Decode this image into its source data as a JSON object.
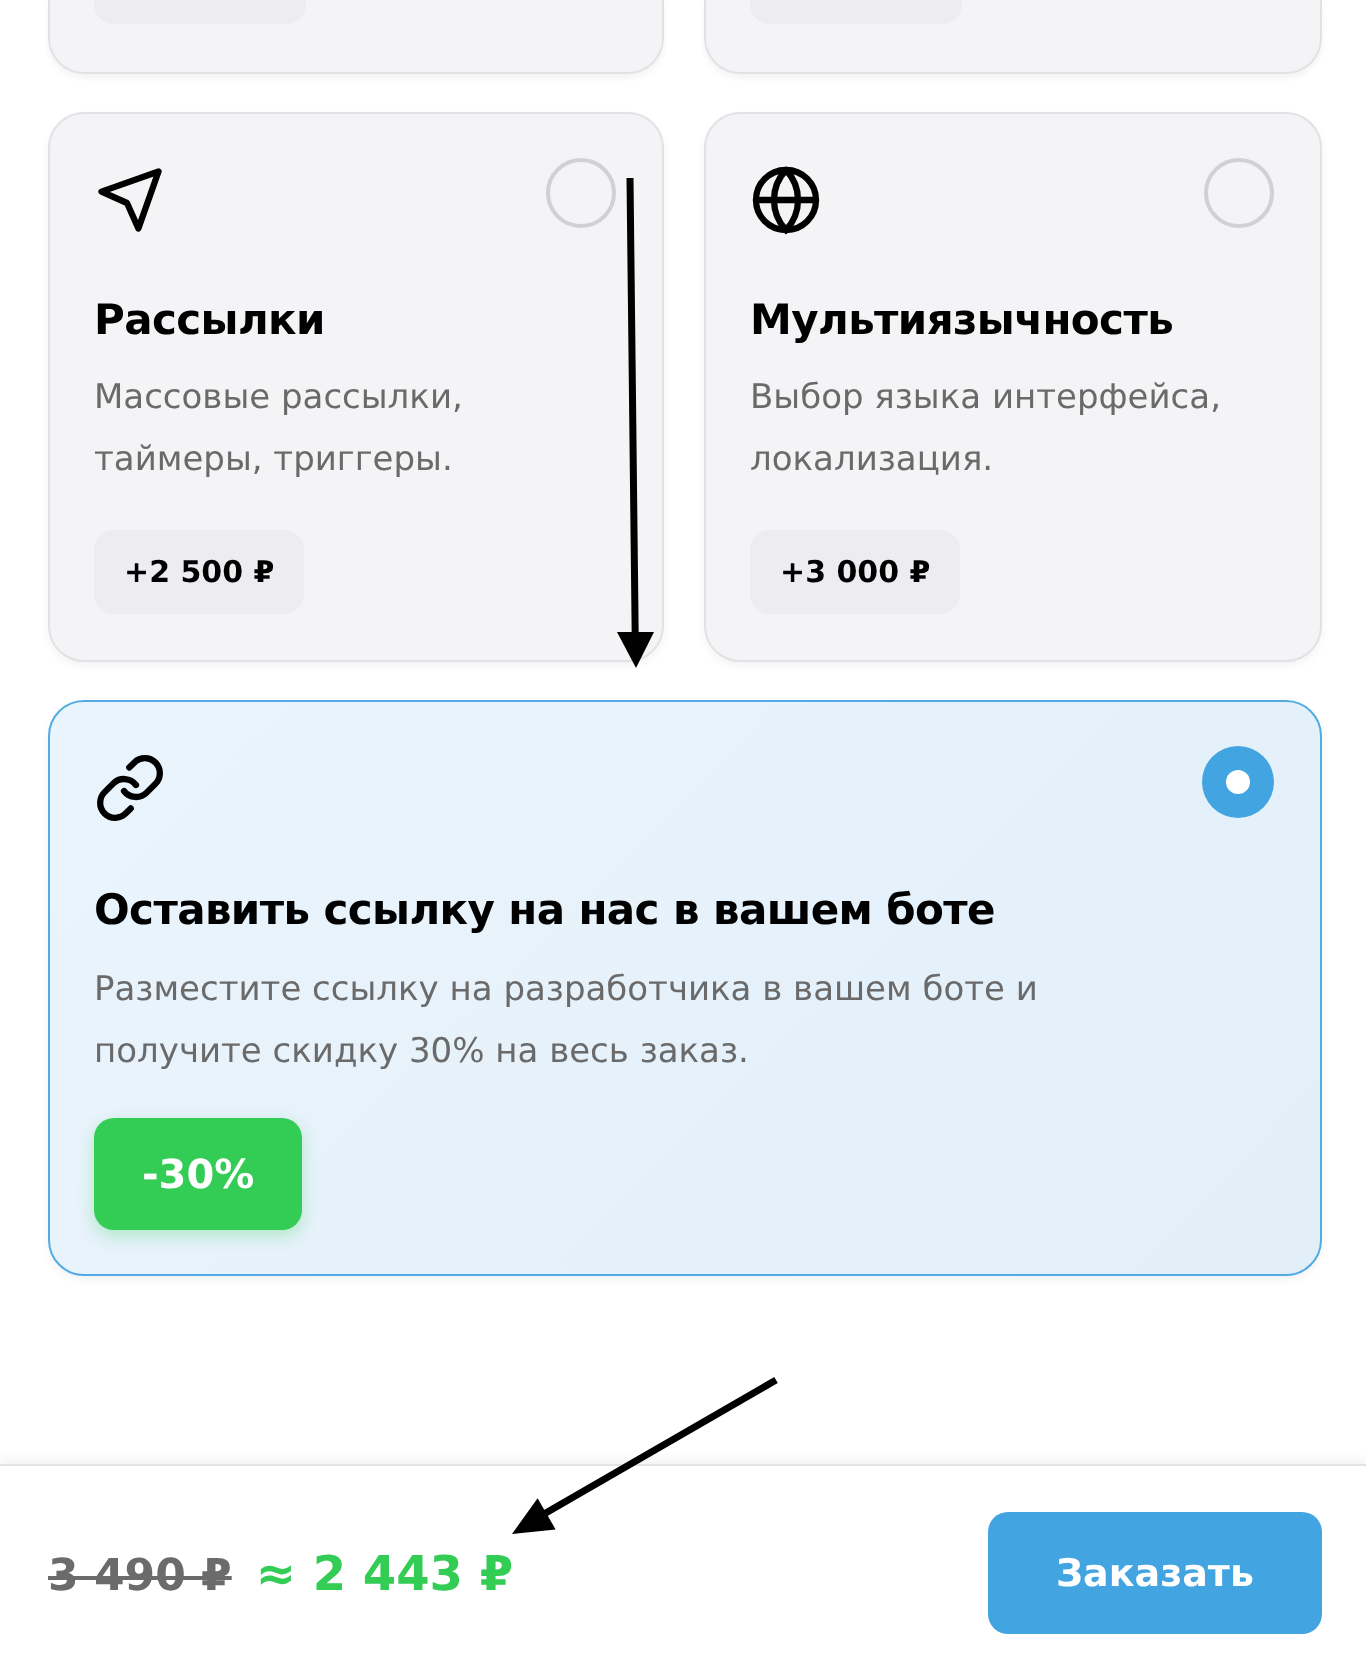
{
  "cut_off_cards": [
    {
      "kind": "option"
    },
    {
      "kind": "option"
    }
  ],
  "options": [
    {
      "kind": "addon",
      "title": "Рассылки",
      "description": "Массовые рассылки, таймеры, триггеры.",
      "price": "+2 500 ₽",
      "selected": false
    },
    {
      "kind": "addon",
      "title": "Мультиязычность",
      "description": "Выбор языка интерфейса, локализация.",
      "price": "+3 000 ₽",
      "selected": false
    },
    {
      "kind": "discount",
      "title": "Оставить ссылку на нас в вашем боте",
      "description": "Разместите ссылку на разработчика в вашем боте и получите скидку 30% на весь заказ.",
      "price": "-30%",
      "selected": true
    }
  ],
  "total": {
    "old_price": "3 490 ₽",
    "new_price": "≈ 2 443 ₽"
  },
  "order_button": "Заказать"
}
